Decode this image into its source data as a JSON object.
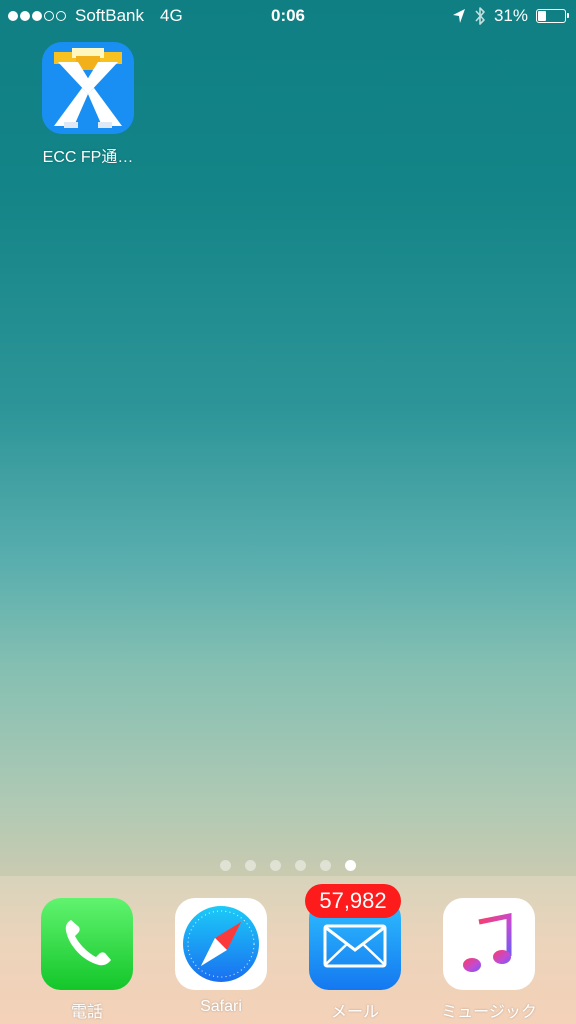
{
  "status_bar": {
    "signal_strength": 3,
    "signal_max": 5,
    "carrier": "SoftBank",
    "network": "4G",
    "time": "0:06",
    "battery_percent_label": "31%",
    "battery_level": 0.31,
    "icons": [
      "location-arrow-icon",
      "bluetooth-icon",
      "battery-icon"
    ]
  },
  "home_apps": [
    {
      "label": "ECC FP通…",
      "icon": "ecc-fp-app-icon",
      "color": "#1a8ff3"
    }
  ],
  "page_indicator": {
    "count": 6,
    "active_index": 5
  },
  "dock": {
    "apps": [
      {
        "label": "電話",
        "icon": "phone-icon",
        "color": "#2bd240"
      },
      {
        "label": "Safari",
        "icon": "safari-compass-icon",
        "color": "#1e8ef4"
      },
      {
        "label": "メール",
        "icon": "mail-envelope-icon",
        "color": "#1e8ef4",
        "badge": "57,982"
      },
      {
        "label": "ミュージック",
        "icon": "music-note-icon",
        "color": "#f0436a"
      }
    ]
  }
}
